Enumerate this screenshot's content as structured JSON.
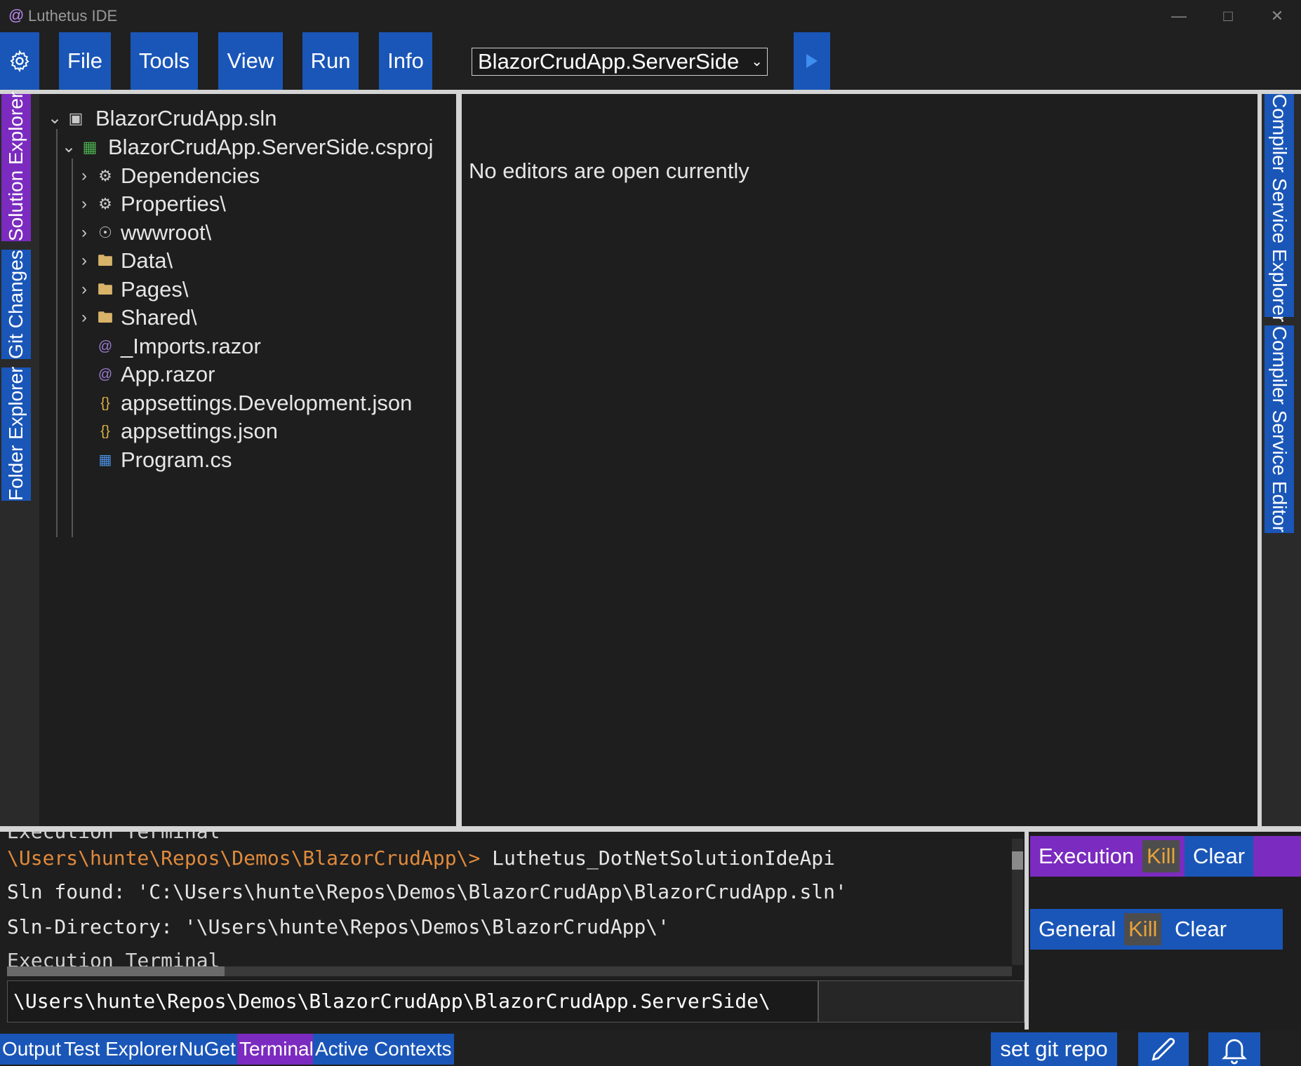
{
  "window": {
    "title": "Luthetus IDE",
    "app_icon_glyph": "@"
  },
  "menu": {
    "items": [
      "File",
      "Tools",
      "View",
      "Run",
      "Info"
    ],
    "project_select_value": "BlazorCrudApp.ServerSide"
  },
  "left_tabs": [
    "Solution Explorer",
    "Git Changes",
    "Folder Explorer"
  ],
  "right_tabs": [
    "Compiler Service Explorer",
    "Compiler Service Editor"
  ],
  "tree": {
    "solution": "BlazorCrudApp.sln",
    "project": "BlazorCrudApp.ServerSide.csproj",
    "items": [
      {
        "label": "Dependencies",
        "icon": "dependencies-icon"
      },
      {
        "label": "Properties\\",
        "icon": "gear-icon"
      },
      {
        "label": "wwwroot\\",
        "icon": "globe-icon"
      },
      {
        "label": "Data\\",
        "icon": "folder-icon"
      },
      {
        "label": "Pages\\",
        "icon": "folder-icon"
      },
      {
        "label": "Shared\\",
        "icon": "folder-icon"
      },
      {
        "label": "_Imports.razor",
        "icon": "razor-icon"
      },
      {
        "label": "App.razor",
        "icon": "razor-icon"
      },
      {
        "label": "appsettings.Development.json",
        "icon": "json-icon"
      },
      {
        "label": "appsettings.json",
        "icon": "json-icon"
      },
      {
        "label": "Program.cs",
        "icon": "csharp-file-icon"
      }
    ]
  },
  "editor": {
    "empty_message": "No editors are open currently"
  },
  "terminal": {
    "cut_header": "Execution Terminal",
    "prompt": "\\Users\\hunte\\Repos\\Demos\\BlazorCrudApp\\>",
    "command": " Luthetus_DotNetSolutionIdeApi",
    "line2": "Sln found: 'C:\\Users\\hunte\\Repos\\Demos\\BlazorCrudApp\\BlazorCrudApp.sln'",
    "line3": "Sln-Directory: '\\Users\\hunte\\Repos\\Demos\\BlazorCrudApp\\'",
    "footer": "Execution Terminal",
    "input_value": "\\Users\\hunte\\Repos\\Demos\\BlazorCrudApp\\BlazorCrudApp.ServerSide\\"
  },
  "terminals": [
    {
      "name": "Execution",
      "kill": "Kill",
      "clear": "Clear",
      "active": true
    },
    {
      "name": "General",
      "kill": "Kill",
      "clear": "Clear",
      "active": false
    }
  ],
  "bottom_tabs": [
    "Output",
    "Test Explorer",
    "NuGet",
    "Terminal",
    "Active Contexts"
  ],
  "active_bottom_tab": "Terminal",
  "status": {
    "git_button": "set git repo"
  },
  "colors": {
    "accent_blue": "#1a56b8",
    "accent_purple": "#7b2bbf",
    "prompt_orange": "#e08a3c",
    "kill_orange": "#e8a43a"
  }
}
